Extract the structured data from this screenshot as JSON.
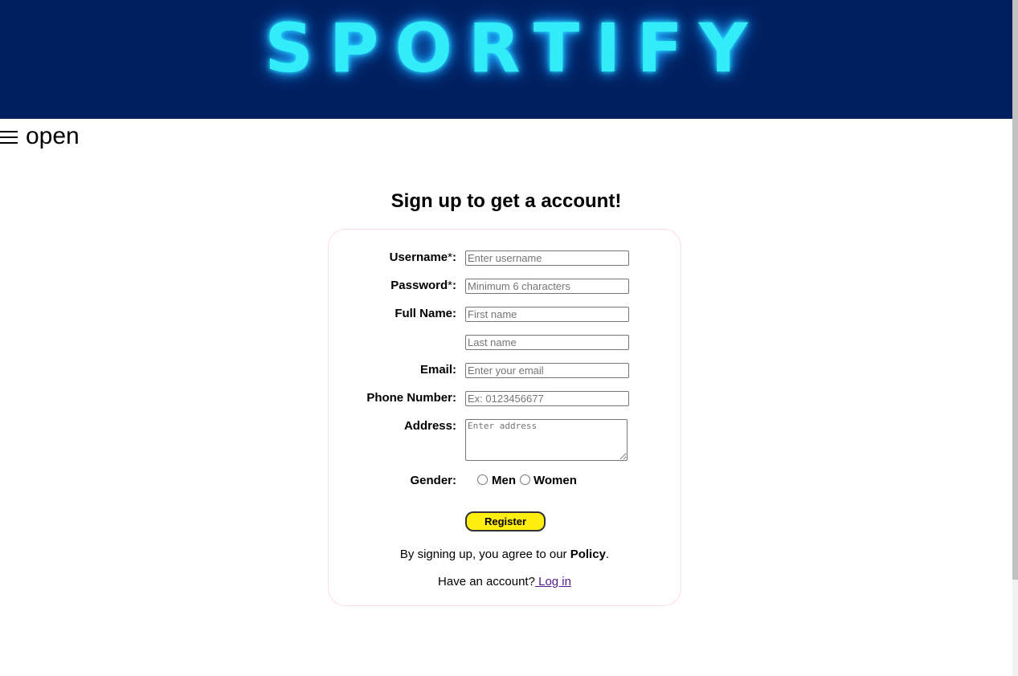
{
  "header": {
    "logo_text": "SPORTIFY",
    "background_color": "#001f5f",
    "logo_color": "#33ecfa"
  },
  "nav": {
    "toggle_icon": "hamburger-icon",
    "toggle_label": "open"
  },
  "form": {
    "heading": "Sign up to get a account!",
    "fields": {
      "username": {
        "label": "Username",
        "required_mark": "*",
        "suffix": ":",
        "placeholder": "Enter username",
        "value": ""
      },
      "password": {
        "label": "Password",
        "required_mark": "*",
        "suffix": ":",
        "placeholder": "Minimum 6 characters",
        "value": ""
      },
      "full_name": {
        "label": "Full Name:",
        "first_placeholder": "First name",
        "last_placeholder": "Last name"
      },
      "email": {
        "label": "Email:",
        "placeholder": "Enter your email",
        "value": ""
      },
      "phone": {
        "label": "Phone Number:",
        "placeholder": "Ex: 0123456677",
        "value": ""
      },
      "address": {
        "label": "Address:",
        "placeholder": "Enter address",
        "value": ""
      },
      "gender": {
        "label": "Gender:",
        "options": [
          "Men",
          "Women"
        ],
        "selected": null
      }
    },
    "submit_label": "Register",
    "submit_color": "#ffee10",
    "policy_prefix": "By signing up, you agree to our ",
    "policy_link": "Policy",
    "policy_suffix": ".",
    "login_prompt": "Have an account?",
    "login_link": " Log in"
  }
}
